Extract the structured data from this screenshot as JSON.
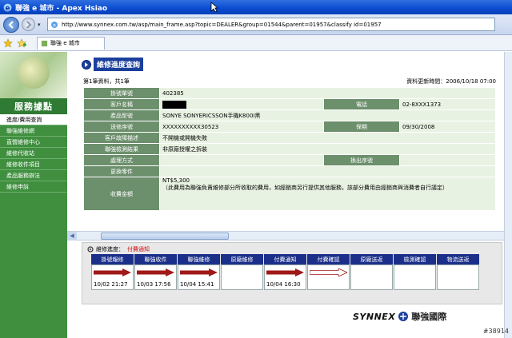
{
  "window": {
    "title": "聯強 e 城市 - Apex Hsiao"
  },
  "browser": {
    "address": "http://www.synnex.com.tw/asp/main_frame.asp?topic=DEALER&group=01544&parent=01957&classify id=01957",
    "tab_title": "聯強 e 城市"
  },
  "sidebar": {
    "title": "服務據點",
    "items": [
      {
        "label": "進度/費用查詢",
        "active": true
      },
      {
        "label": "聯強維修網",
        "active": false
      },
      {
        "label": "直營維修中心",
        "active": false
      },
      {
        "label": "維修代收站",
        "active": false
      },
      {
        "label": "維修收件項目",
        "active": false
      },
      {
        "label": "產品服務辦法",
        "active": false
      },
      {
        "label": "維修申訴",
        "active": false
      }
    ]
  },
  "page": {
    "heading": "維修進度查詢",
    "record_info": "第1筆資料，共1筆",
    "update_info": "資料更新時間：2006/10/18 07:00"
  },
  "detail": {
    "ticket_label": "掛號單號",
    "ticket_value": "402385",
    "customer_label": "客戶名稱",
    "phone_label": "電話",
    "phone_value": "02-8XXX1373",
    "model_label": "產品型號",
    "model_value": "SONYE SONYERICSSON手機K800I黑",
    "serial_label": "送修序號",
    "serial_value": "XXXXXXXXXX30523",
    "warranty_label": "保期",
    "warranty_value": "09/30/2008",
    "fault_label": "客戶故障描述",
    "fault_value": "不開機或開機失敗",
    "diagnosis_label": "聯強檢測結果",
    "diagnosis_value": "非原廠授權之拆裝",
    "handling_label": "處理方式",
    "print_button": "換出序號",
    "parts_label": "更換零件",
    "fee_label": "收費金額",
    "fee_amount": "NT$5,300",
    "fee_note": "（此費用為聯強負責維修部分所收取的費用，如經銷商另行提供其他服務，該部分費用由經銷商與消費者自行議定）"
  },
  "progress": {
    "heading": "維修進度：",
    "current": "付費通知",
    "steps": [
      {
        "label": "掛號報修",
        "date": "10/02 21:27",
        "state": "done"
      },
      {
        "label": "聯強收件",
        "date": "10/03 17:56",
        "state": "done"
      },
      {
        "label": "聯強維修",
        "date": "10/04 15:41",
        "state": "done"
      },
      {
        "label": "原廠維修",
        "date": "",
        "state": "none"
      },
      {
        "label": "付費通知",
        "date": "10/04 16:30",
        "state": "done"
      },
      {
        "label": "付費確認",
        "date": "",
        "state": "next"
      },
      {
        "label": "原廠送返",
        "date": "",
        "state": "none"
      },
      {
        "label": "檢測確認",
        "date": "",
        "state": "none"
      },
      {
        "label": "物流送返",
        "date": "",
        "state": "none"
      }
    ]
  },
  "footer": {
    "brand": "SYNNEX",
    "brand_cn": "聯強國際",
    "watermark": "#38914"
  },
  "colors": {
    "accent": "#1b2f8a",
    "sidebar": "#3f8f3f",
    "label_cell": "#6c8f6c",
    "arrow_done": "#a01818"
  }
}
